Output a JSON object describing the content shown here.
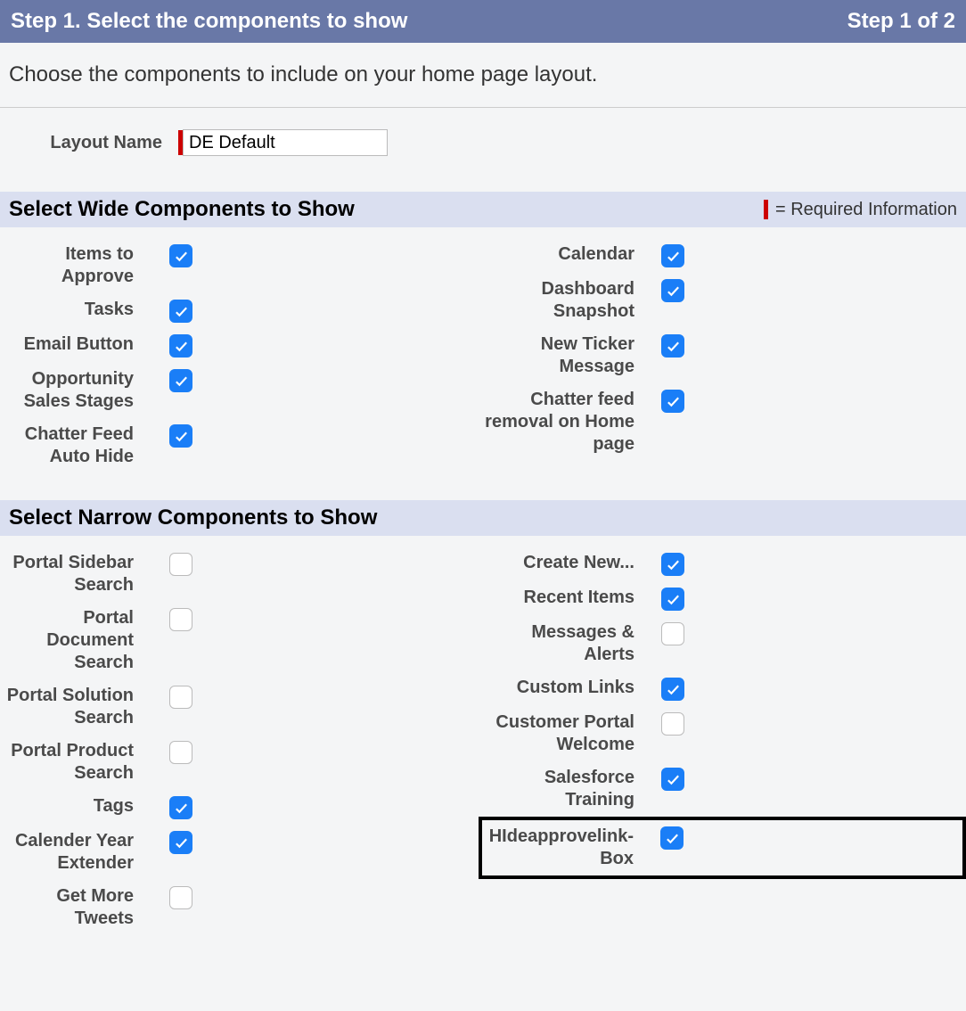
{
  "header": {
    "step_title": "Step 1. Select the components to show",
    "step_counter": "Step 1 of 2"
  },
  "instruction": "Choose the components to include on your home page layout.",
  "layoutName": {
    "label": "Layout Name",
    "value": "DE Default"
  },
  "requiredInfoText": "= Required Information",
  "sections": {
    "wide": {
      "title": "Select Wide Components to Show",
      "left": [
        {
          "label": "Items to Approve",
          "checked": true
        },
        {
          "label": "Tasks",
          "checked": true
        },
        {
          "label": "Email Button",
          "checked": true
        },
        {
          "label": "Opportunity Sales Stages",
          "checked": true
        },
        {
          "label": "Chatter Feed Auto Hide",
          "checked": true
        }
      ],
      "right": [
        {
          "label": "Calendar",
          "checked": true
        },
        {
          "label": "Dashboard Snapshot",
          "checked": true
        },
        {
          "label": "New Ticker Message",
          "checked": true
        },
        {
          "label": "Chatter feed removal on Home page",
          "checked": true
        }
      ]
    },
    "narrow": {
      "title": "Select Narrow Components to Show",
      "left": [
        {
          "label": "Portal Sidebar Search",
          "checked": false
        },
        {
          "label": "Portal Document Search",
          "checked": false
        },
        {
          "label": "Portal Solution Search",
          "checked": false
        },
        {
          "label": "Portal Product Search",
          "checked": false
        },
        {
          "label": "Tags",
          "checked": true
        },
        {
          "label": "Calender Year Extender",
          "checked": true
        },
        {
          "label": "Get More Tweets",
          "checked": false
        }
      ],
      "right": [
        {
          "label": "Create New...",
          "checked": true
        },
        {
          "label": "Recent Items",
          "checked": true
        },
        {
          "label": "Messages & Alerts",
          "checked": false
        },
        {
          "label": "Custom Links",
          "checked": true
        },
        {
          "label": "Customer Portal Welcome",
          "checked": false
        },
        {
          "label": "Salesforce Training",
          "checked": true
        },
        {
          "label": "HIdeapprovelink-Box",
          "checked": true,
          "highlighted": true
        }
      ]
    }
  }
}
